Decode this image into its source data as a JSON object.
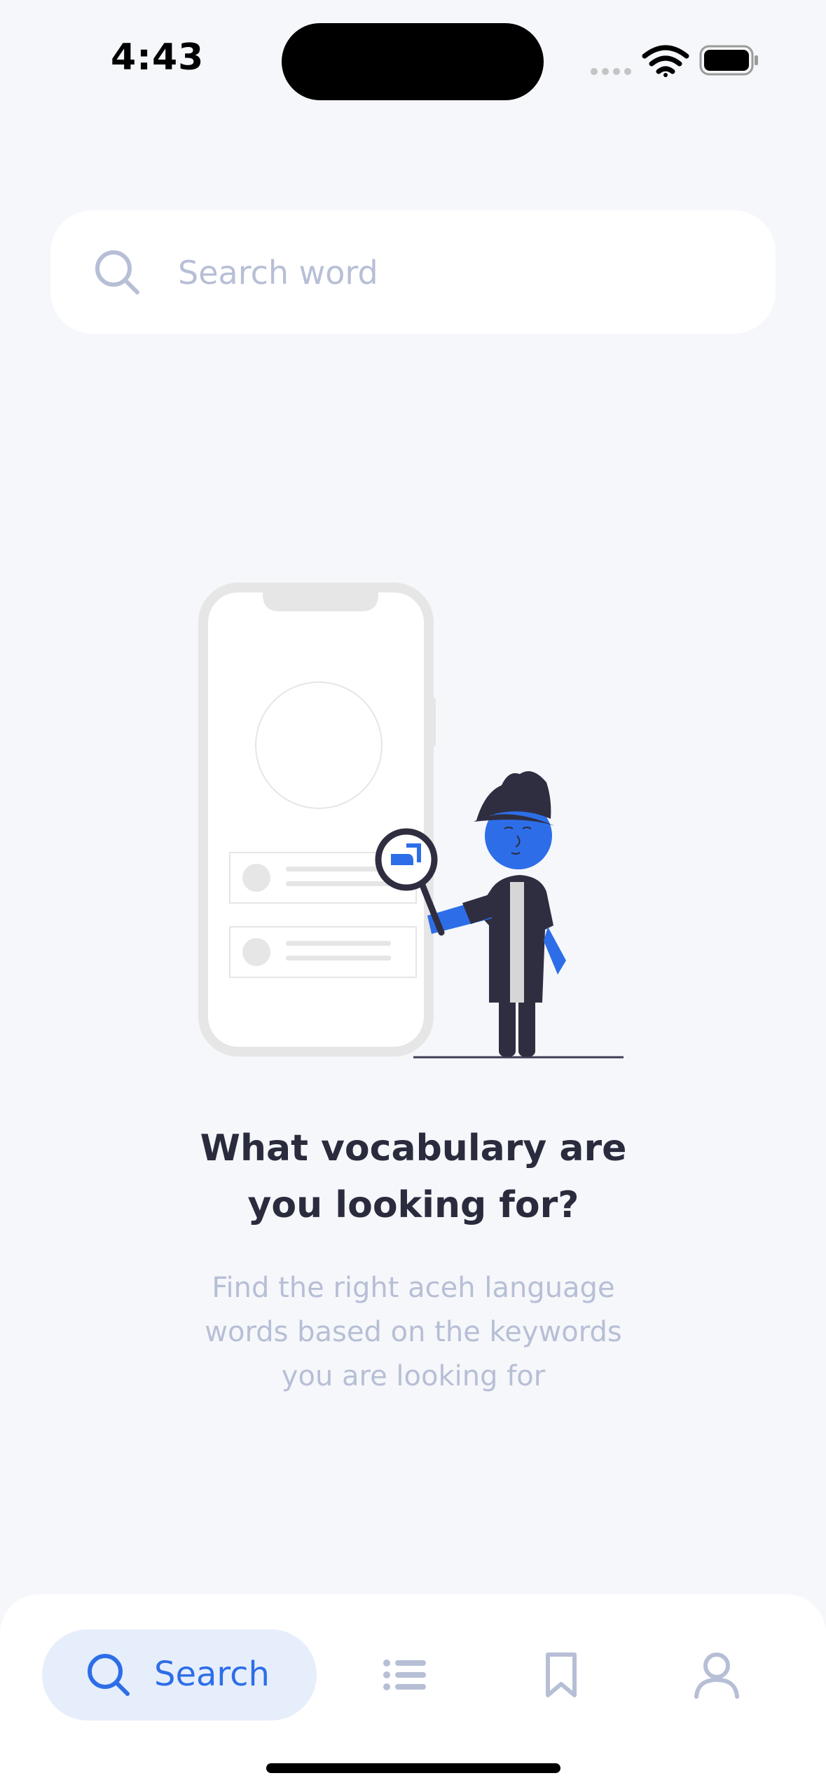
{
  "status_bar": {
    "time": "4:43"
  },
  "search": {
    "placeholder": "Search word",
    "value": "",
    "icon": "search-icon"
  },
  "empty_state": {
    "title": "What vocabulary are you looking for?",
    "title_lines": [
      "What vocabulary are",
      "you looking for?"
    ],
    "subtitle_lines": [
      "Find the right aceh language",
      "words based on the keywords",
      "you are looking for"
    ]
  },
  "bottom_nav": {
    "items": [
      {
        "label": "Search",
        "icon": "search-icon",
        "active": true
      },
      {
        "icon": "list-icon",
        "active": false
      },
      {
        "icon": "bookmark-icon",
        "active": false
      },
      {
        "icon": "user-icon",
        "active": false
      }
    ]
  },
  "colors": {
    "background": "#f5f7fa",
    "accent": "#2d6ee8",
    "accent_soft": "#e7eefb",
    "text_dark": "#2a2c3e",
    "text_muted": "#b7bfd6"
  }
}
